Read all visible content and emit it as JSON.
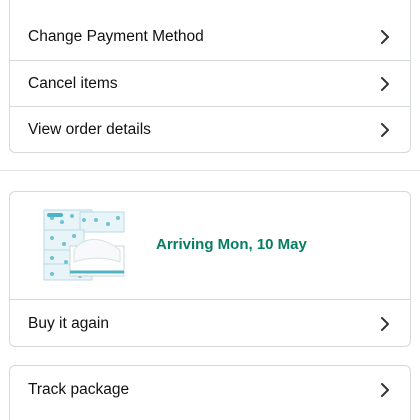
{
  "actions": [
    {
      "label": "Change Payment Method"
    },
    {
      "label": "Cancel items"
    },
    {
      "label": "View order details"
    }
  ],
  "shipment": {
    "arrival_text": "Arriving Mon, 10 May",
    "product_image": "tissue-box-pack-image",
    "buy_again_label": "Buy it again"
  },
  "tracking": {
    "track_label": "Track package"
  },
  "colors": {
    "arrival_green": "#067d62",
    "border": "#d5d9d9"
  },
  "icons": {
    "chevron": "chevron-right-icon"
  }
}
